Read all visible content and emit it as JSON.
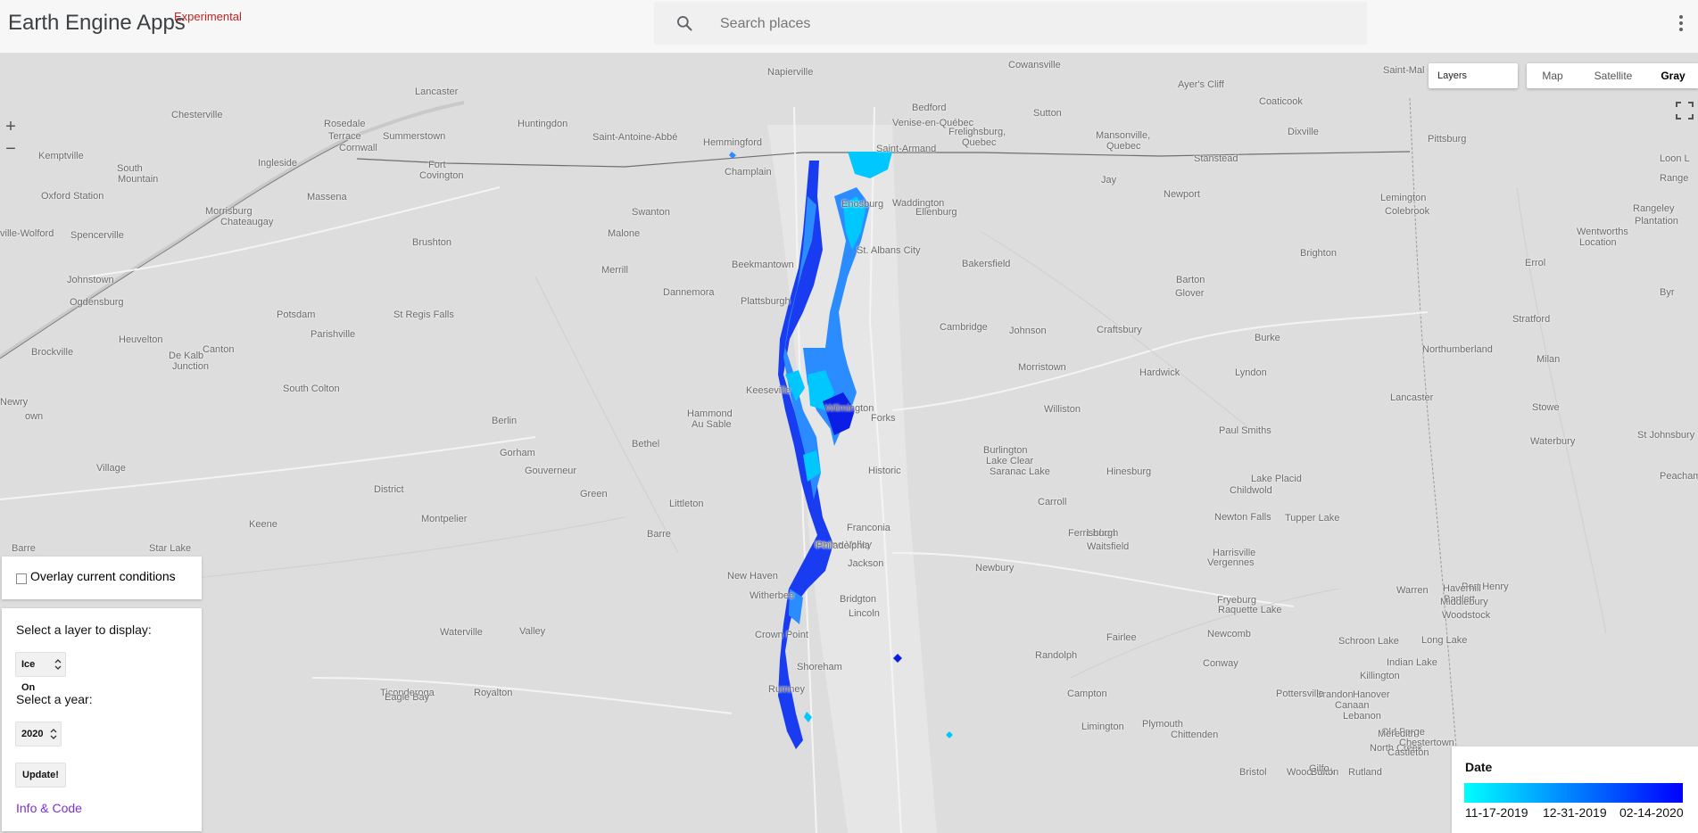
{
  "header": {
    "title": "Earth Engine Apps",
    "badge": "Experimental",
    "search_placeholder": "Search places",
    "search_icon": "search-icon",
    "menu_icon": "more-vert-icon"
  },
  "map_controls": {
    "zoom_in": "+",
    "zoom_out": "−",
    "layers_label": "Layers",
    "map_types": [
      {
        "label": "Map",
        "active": false
      },
      {
        "label": "Satellite",
        "active": false
      },
      {
        "label": "Gray",
        "active": true
      }
    ],
    "fullscreen_icon": "fullscreen-icon"
  },
  "map_labels": [
    "Lancaster",
    "Chesterville",
    "Napierville",
    "Cowansville",
    "Ayer's Cliff",
    "Saint-Mal",
    "Rosedale",
    "Terrace",
    "Summerstown",
    "Huntingdon",
    "Bedford",
    "Sutton",
    "Coaticook",
    "Kemptville",
    "Cornwall",
    "Ingleside",
    "Saint-Antoine-Abbé",
    "Hemmingford",
    "Venise-en-Québec",
    "Frelighsburg,",
    "Quebec",
    "Mansonville,",
    "Quebec",
    "Dixville",
    "South",
    "Mountain",
    "Fort",
    "Covington",
    "Saint-Armand",
    "Stanstead",
    "Pittsburg",
    "Loon L",
    "Range",
    "Oxford Station",
    "Massena",
    "Champlain",
    "Jay",
    "Newport",
    "Morrisburg",
    "Chateaugay",
    "Swanton",
    "Enosburg",
    "Lemington",
    "Colebrook",
    "Waddington",
    "Ellenburg",
    "Rangeley",
    "Plantation",
    "ville-Wolford",
    "Spencerville",
    "Brushton",
    "Malone",
    "St. Albans City",
    "Wentworths",
    "Location",
    "Bakersfield",
    "Johnstown",
    "Merrill",
    "Beekmantown",
    "Barton",
    "Brighton",
    "Errol",
    "Ogdensburg",
    "Dannemora",
    "Glover",
    "Potsdam",
    "St Regis Falls",
    "Plattsburgh",
    "Cambridge",
    "Johnson",
    "Craftsbury",
    "Stratford",
    "Byr",
    "Parishville",
    "Burke",
    "Heuvelton",
    "Brockville",
    "Canton",
    "Northumberland",
    "Milan",
    "Morristown",
    "Hardwick",
    "Lyndon",
    "De Kalb",
    "Junction",
    "South Colton",
    "Keeseville",
    "Lancaster",
    "Newry",
    "own",
    "Hammond",
    "Au Sable",
    "Forks",
    "Williston",
    "Stowe",
    "Berlin",
    "Paul Smiths",
    "St Johnsbury",
    "Bethel",
    "Wilmington",
    "Burlington",
    "Waterbury",
    "Gorham",
    "Lake Clear",
    "Village",
    "Gouverneur",
    "Saranac Lake",
    "Historic",
    "Hinesburg",
    "Peacham",
    "District",
    "Green",
    "Childwold",
    "Lake Placid",
    "Littleton",
    "Carroll",
    "Keene",
    "Montpelier",
    "Newton Falls",
    "Tupper Lake",
    "Franconia",
    "Lisbon",
    "Ferrisburgh",
    "Barre",
    "Waitsfield",
    "Keene Valley",
    "Barre",
    "Star Lake",
    "Philadelphia",
    "Harrisville",
    "Vergennes",
    "Jackson",
    "Newbury",
    "New Haven",
    "Warren",
    "Witherbee",
    "Bartlett",
    "Bridgton",
    "Port Henry",
    "Haverhill",
    "Lincoln",
    "Fryeburg",
    "Middlebury",
    "Woodstock",
    "Waterville",
    "Valley",
    "Long Lake",
    "Newcomb",
    "Conway",
    "Crown Point",
    "Shoreham",
    "Randolph",
    "Fairlee",
    "Raquette Lake",
    "Schroon Lake",
    "Ticonderoga",
    "Royalton",
    "Campton",
    "Indian Lake",
    "Rumney",
    "Eagle Bay",
    "Brandon",
    "Plymouth",
    "Pottersville",
    "Chittenden",
    "Limington",
    "Old Forge",
    "North Creek",
    "Killington",
    "Hanover",
    "Canaan",
    "Lebanon",
    "Meredith",
    "Chestertown",
    "Castleton",
    "Rutland",
    "Woodstock",
    "Bristol",
    "Bolton",
    "Gilfo"
  ],
  "overlay": {
    "checkbox_label": "Overlay current conditions",
    "checked": false
  },
  "controls": {
    "layer_prompt": "Select a layer to display:",
    "layer_value": "Ice On",
    "year_prompt": "Select a year:",
    "year_value": "2020",
    "update_label": "Update!",
    "info_link": "Info & Code"
  },
  "legend": {
    "title": "Date",
    "color_start": "#00ffff",
    "color_end": "#0000ff",
    "ticks": [
      "11-17-2019",
      "12-31-2019",
      "02-14-2020"
    ]
  },
  "layer_colors": {
    "early": "#00c8ff",
    "mid": "#2a8cff",
    "late": "#0a1ee6"
  }
}
